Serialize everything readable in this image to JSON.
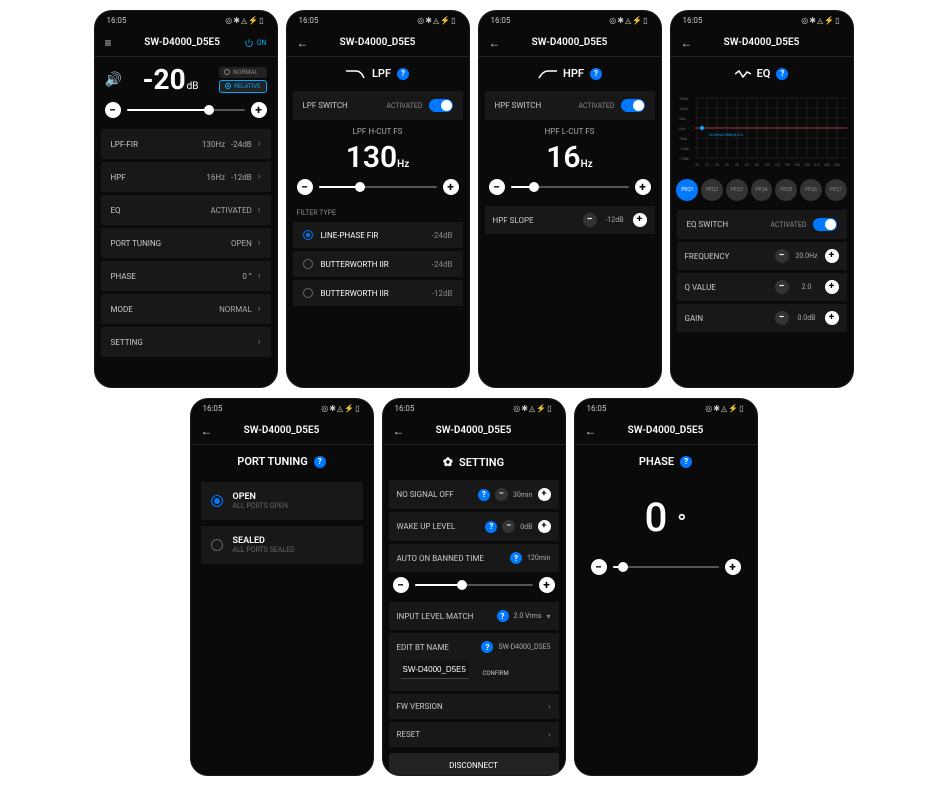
{
  "common": {
    "status_time": "16:05",
    "status_icons": "◎✱◬⚡▯",
    "device_title": "SW-D4000_D5E5",
    "power_on": "ON"
  },
  "screen1": {
    "gain_value": "-20",
    "gain_unit": "dB",
    "mode_normal": "NORMAL",
    "mode_relative": "RELATIVE",
    "slider_pct": 70,
    "rows": [
      {
        "label": "LPF-FIR",
        "v1": "130Hz",
        "v2": "-24dB"
      },
      {
        "label": "HPF",
        "v1": "16Hz",
        "v2": "-12dB"
      },
      {
        "label": "EQ",
        "v1": "",
        "v2": "ACTIVATED"
      },
      {
        "label": "PORT TUNING",
        "v1": "",
        "v2": "OPEN"
      },
      {
        "label": "PHASE",
        "v1": "",
        "v2": "0 °"
      },
      {
        "label": "MODE",
        "v1": "",
        "v2": "NORMAL"
      },
      {
        "label": "SETTING",
        "v1": "",
        "v2": ""
      }
    ]
  },
  "screen2": {
    "title": "LPF",
    "switch_label": "LPF SWITCH",
    "switch_state": "ACTIVATED",
    "fs_label": "LPF H-CUT FS",
    "fs_value": "130",
    "fs_unit": "Hz",
    "slider_pct": 35,
    "filter_section": "FILTER TYPE",
    "filters": [
      {
        "name": "LINE-PHASE FIR",
        "val": "-24dB",
        "sel": true
      },
      {
        "name": "BUTTERWORTH IIR",
        "val": "-24dB",
        "sel": false
      },
      {
        "name": "BUTTERWORTH IIR",
        "val": "-12dB",
        "sel": false
      }
    ]
  },
  "screen3": {
    "title": "HPF",
    "switch_label": "HPF SWITCH",
    "switch_state": "ACTIVATED",
    "fs_label": "HPF L-CUT FS",
    "fs_value": "16",
    "fs_unit": "Hz",
    "slider_pct": 20,
    "slope_label": "HPF SLOPE",
    "slope_value": "-12dB"
  },
  "screen4": {
    "title": "EQ",
    "yticks": [
      "15db",
      "10db",
      "5db",
      "0db",
      "-5db",
      "-10db",
      "-15db"
    ],
    "xticks": [
      "20",
      "25",
      "30",
      "40",
      "50",
      "63",
      "80",
      "100",
      "125",
      "160",
      "200",
      "250",
      "315",
      "400",
      "500"
    ],
    "tooltip": "20.0Hz,0.0dB,Q:2.0",
    "peq_tabs": [
      "PEQ1",
      "PEQ2",
      "PEQ3",
      "PEQ4",
      "PEQ5",
      "PEQ6",
      "PEQ7"
    ],
    "peq_active": 0,
    "switch_label": "EQ SWITCH",
    "switch_state": "ACTIVATED",
    "params": [
      {
        "label": "FREQUENCY",
        "val": "20.0Hz"
      },
      {
        "label": "Q VALUE",
        "val": "2.0"
      },
      {
        "label": "GAIN",
        "val": "0.0dB"
      }
    ]
  },
  "screen5": {
    "title": "PORT TUNING",
    "opts": [
      {
        "t": "OPEN",
        "s": "ALL PORTS OPEN",
        "sel": true
      },
      {
        "t": "SEALED",
        "s": "ALL PORTS SEALED",
        "sel": false
      }
    ]
  },
  "screen6": {
    "title": "SETTING",
    "no_signal_label": "NO SIGNAL OFF",
    "no_signal_val": "30min",
    "wake_label": "WAKE UP LEVEL",
    "wake_val": "0dB",
    "auto_label": "AUTO ON BANNED TIME",
    "auto_val": "120min",
    "auto_slider_pct": 40,
    "input_match_label": "INPUT LEVEL MATCH",
    "input_match_val": "2.0 Vrms",
    "bt_label": "EDIT BT NAME",
    "bt_right": "SW-D4000_D5E5",
    "bt_input_val": "SW-D4000_D5E5",
    "confirm": "CONFIRM",
    "fw_label": "FW VERSION",
    "reset_label": "RESET",
    "disconnect": "DISCONNECT"
  },
  "screen7": {
    "title": "PHASE",
    "value": "0",
    "unit": "°",
    "slider_pct": 10
  }
}
